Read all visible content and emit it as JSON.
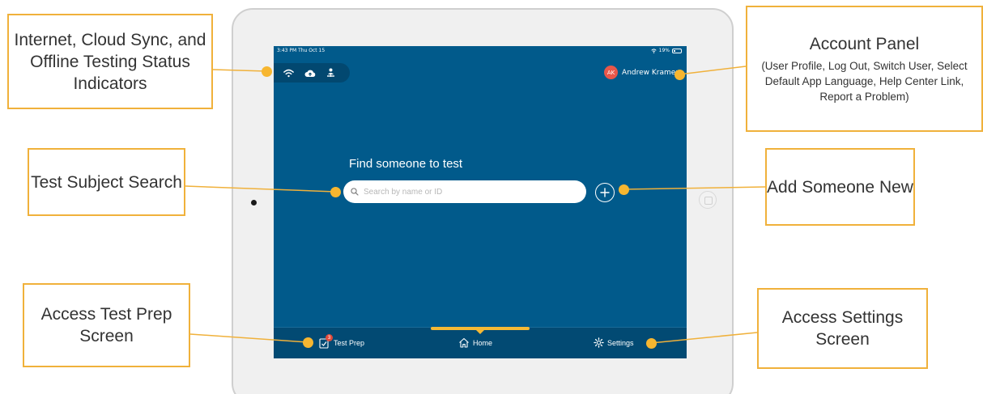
{
  "status_bar": {
    "time": "3:43 PM  Thu Oct 15",
    "battery": "19%"
  },
  "account": {
    "initials": "AK",
    "name": "Andrew Kramer"
  },
  "main": {
    "title": "Find someone to test",
    "search_placeholder": "Search by name or ID"
  },
  "tabs": {
    "test_prep": {
      "label": "Test Prep",
      "badge": "3"
    },
    "home": {
      "label": "Home"
    },
    "settings": {
      "label": "Settings"
    }
  },
  "callouts": {
    "status": {
      "title": "Internet, Cloud Sync, and Offline Testing Status Indicators"
    },
    "account": {
      "title": "Account Panel",
      "subtitle": "(User Profile, Log Out, Switch User, Select Default App Language, Help Center Link, Report a Problem)"
    },
    "search": {
      "title": "Test Subject Search"
    },
    "add": {
      "title": "Add Someone New"
    },
    "prep": {
      "title": "Access Test Prep Screen"
    },
    "settings": {
      "title": "Access Settings Screen"
    }
  },
  "icons": {
    "wifi": "wifi-icon",
    "cloud": "cloud-upload-icon",
    "offline": "offline-testing-icon",
    "search": "search-icon",
    "add": "plus-circle-icon",
    "prep": "clipboard-check-icon",
    "home": "home-icon",
    "settings": "gear-icon"
  },
  "colors": {
    "screen_bg": "#015a8b",
    "tabbar_bg": "#024a73",
    "accent": "#f5b935",
    "callout_border": "#f0b13b",
    "avatar": "#e8574a"
  }
}
